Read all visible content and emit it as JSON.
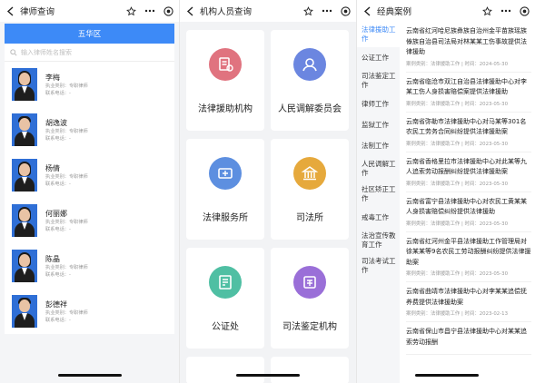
{
  "panel1": {
    "title": "律师查询",
    "region": "五华区",
    "search_placeholder": "输入律师姓名搜索",
    "lawyers": [
      {
        "name": "李梅",
        "practice": "执业类别：专职律师",
        "phone": "联系电话：-",
        "gender": "female"
      },
      {
        "name": "胡逸波",
        "practice": "执业类别：专职律师",
        "phone": "联系电话：-",
        "gender": "male"
      },
      {
        "name": "杨倩",
        "practice": "执业类别：专职律师",
        "phone": "联系电话：-",
        "gender": "female"
      },
      {
        "name": "何丽娜",
        "practice": "执业类别：专职律师",
        "phone": "联系电话：-",
        "gender": "female"
      },
      {
        "name": "陈晶",
        "practice": "执业类别：专职律师",
        "phone": "联系电话：-",
        "gender": "female"
      },
      {
        "name": "彭德祥",
        "practice": "执业类别：专职律师",
        "phone": "联系电话：-",
        "gender": "male"
      }
    ]
  },
  "panel2": {
    "title": "机构人员查询",
    "cards": [
      {
        "label": "法律援助机构",
        "icon": "legal-aid-icon",
        "color": "#e0737f"
      },
      {
        "label": "人民调解委员会",
        "icon": "mediation-committee-icon",
        "color": "#6b86e0"
      },
      {
        "label": "法律服务所",
        "icon": "legal-service-icon",
        "color": "#5d8fe0"
      },
      {
        "label": "司法所",
        "icon": "judicial-office-icon",
        "color": "#e6a93c"
      },
      {
        "label": "公证处",
        "icon": "notary-office-icon",
        "color": "#4fbfa3"
      },
      {
        "label": "司法鉴定机构",
        "icon": "forensic-institution-icon",
        "color": "#9a6fd8"
      }
    ]
  },
  "panel3": {
    "title": "经典案例",
    "categories": [
      {
        "label": "法律援助工作",
        "active": true
      },
      {
        "label": "公证工作",
        "active": false
      },
      {
        "label": "司法鉴定工作",
        "active": false
      },
      {
        "label": "律师工作",
        "active": false
      },
      {
        "label": "监狱工作",
        "active": false
      },
      {
        "label": "法制工作",
        "active": false
      },
      {
        "label": "人民调解工作",
        "active": false
      },
      {
        "label": "社区矫正工作",
        "active": false
      },
      {
        "label": "戒毒工作",
        "active": false
      },
      {
        "label": "法治宣传教育工作",
        "active": false
      },
      {
        "label": "司法考试工作",
        "active": false
      }
    ],
    "cases": [
      {
        "title": "云南省红河哈尼族彝族自治州金平苗族瑶族傣族自治县司法局对林某某工伤事故提供法律援助",
        "meta": "案例类别：法律援助工作 | 时间：2024-05-30"
      },
      {
        "title": "云南省临沧市双江自治县法律援助中心对李某工伤人身损害赔偿案提供法律援助",
        "meta": "案例类别：法律援助工作 | 时间：2023-05-30"
      },
      {
        "title": "云南省弥勒市法律援助中心对马某等301名农民工劳务合同纠纷提供法律援助案",
        "meta": "案例类别：法律援助工作 | 时间：2023-05-30"
      },
      {
        "title": "云南省香格里拉市法律援助中心对此某等九人追索劳动报酬纠纷提供法律援助案",
        "meta": "案例类别：法律援助工作 | 时间：2023-05-30"
      },
      {
        "title": "云南省富宁县法律援助中心对农民工黄某某人身损害赔偿纠纷提供法律援助",
        "meta": "案例类别：法律援助工作 | 时间：2023-05-30"
      },
      {
        "title": "云南省红河州金平县法律援助工作管理局对徐某某等9名农民工劳动报酬纠纷提供法律援助案",
        "meta": "案例类别：法律援助工作 | 时间：2023-05-30"
      },
      {
        "title": "云南省曲靖市法律援助中心对李某某追偿抚养费提供法律援助案",
        "meta": "案例类别：法律援助工作 | 时间：2023-02-13"
      },
      {
        "title": "云南省保山市昌宁县法律援助中心对某某追索劳动报酬",
        "meta": ""
      }
    ]
  }
}
